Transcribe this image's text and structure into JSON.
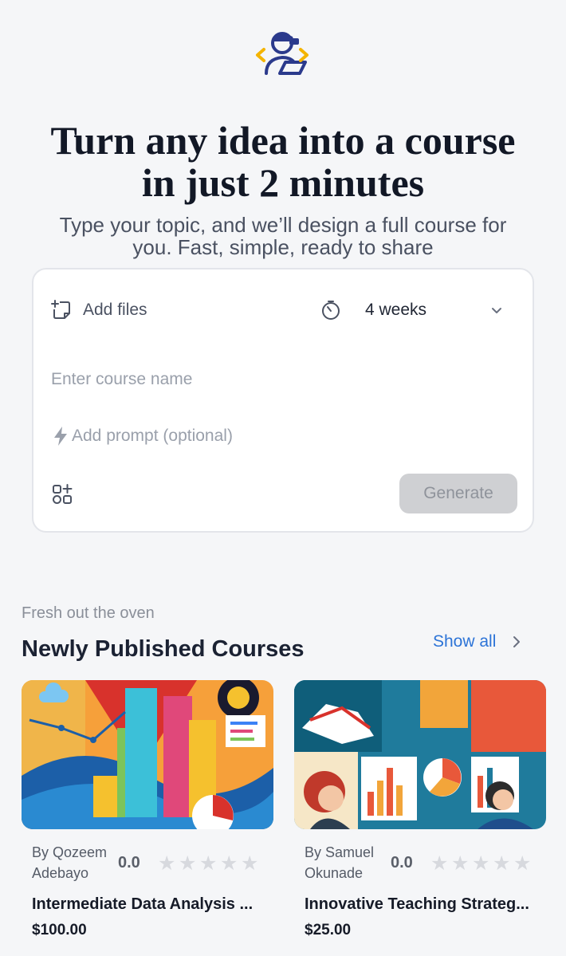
{
  "brand": {
    "logo_icon": "teacher-laptop-code-icon",
    "colors": {
      "navy": "#2b3a8c",
      "accent": "#f4b400"
    }
  },
  "hero": {
    "title_line1": "Turn any idea into a course",
    "title_line2": "in just 2 minutes",
    "subtitle_line1": "Type your topic, and we’ll design a full course for",
    "subtitle_line2": "you. Fast, simple, ready to share"
  },
  "composer": {
    "add_files_label": "Add files",
    "add_files_icon": "file-plus-icon",
    "duration_value": "4 weeks",
    "duration_icon": "timer-icon",
    "course_name_placeholder": "Enter course name",
    "prompt_placeholder": "Add prompt (optional)",
    "prompt_icon": "lightning-icon",
    "apps_icon": "add-widget-icon",
    "generate_label": "Generate"
  },
  "courses_section": {
    "eyebrow": "Fresh out the oven",
    "title": "Newly Published Courses",
    "show_all_label": "Show all",
    "courses": [
      {
        "author_line1": "By Qozeem",
        "author_line2": "Adebayo",
        "rating": "0.0",
        "stars_filled": 0,
        "title": "Intermediate Data Analysis ...",
        "price": "$100.00",
        "thumbnail": "data-analysis-illustration"
      },
      {
        "author_line1": "By Samuel",
        "author_line2": "Okunade",
        "rating": "0.0",
        "stars_filled": 0,
        "title": "Innovative Teaching Strateg...",
        "price": "$25.00",
        "thumbnail": "teaching-strategies-illustration"
      }
    ]
  }
}
